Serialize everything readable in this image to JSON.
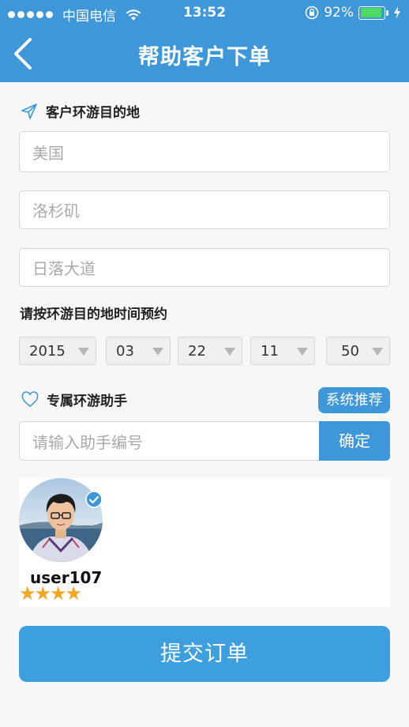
{
  "status_bar": {
    "carrier": "中国电信",
    "time": "13:52",
    "battery": "92%",
    "signal_bars": 5,
    "battery_level": 0.92
  },
  "nav": {
    "title": "帮助客户下单",
    "back_icon": "chevron-left-icon"
  },
  "destination": {
    "label": "客户环游目的地",
    "icon": "paper-plane-icon",
    "fields": [
      {
        "placeholder": "美国"
      },
      {
        "placeholder": "洛杉矶"
      },
      {
        "placeholder": "日落大道"
      }
    ]
  },
  "schedule": {
    "label": "请按环游目的地时间预约",
    "selects": [
      {
        "value": "2015"
      },
      {
        "value": "03"
      },
      {
        "value": "22"
      },
      {
        "value": "11"
      },
      {
        "value": "50"
      }
    ]
  },
  "assistant": {
    "label": "专属环游助手",
    "icon": "heart-icon",
    "recommend_label": "系统推荐",
    "input_placeholder": "请输入助手编号",
    "confirm_label": "确定",
    "card": {
      "username": "user107",
      "rating": 4,
      "stars": "★★★★"
    }
  },
  "submit_label": "提交订单",
  "colors": {
    "primary": "#3d97d8",
    "star": "#f5a623",
    "battery_fill": "#4cd964"
  }
}
